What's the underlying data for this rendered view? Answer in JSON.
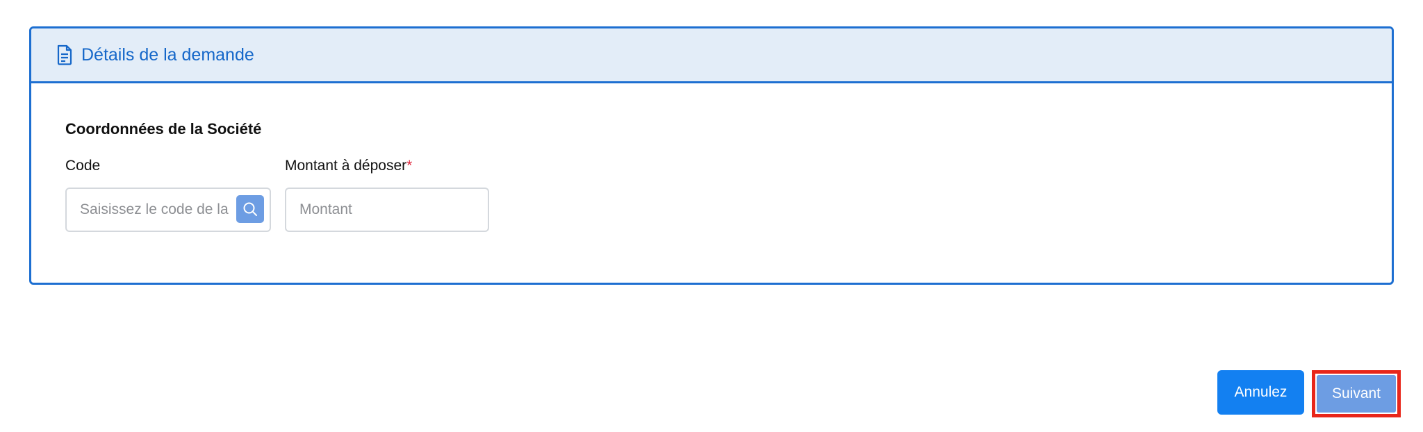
{
  "card": {
    "title": "Détails de la demande",
    "title_icon": "document-icon"
  },
  "section": {
    "title": "Coordonnées de la Société"
  },
  "fields": {
    "code": {
      "label": "Code",
      "placeholder": "Saisissez le code de la",
      "value": "",
      "button_icon": "search-icon"
    },
    "montant": {
      "label": "Montant à déposer",
      "required_mark": "*",
      "placeholder": "Montant",
      "value": ""
    }
  },
  "actions": {
    "cancel_label": "Annulez",
    "next_label": "Suivant"
  },
  "colors": {
    "primary": "#1380f1",
    "primary_disabled": "#6d9de3",
    "header_bg": "#e3edf8",
    "border": "#1d6fd1",
    "required": "#e0243b",
    "highlight": "#e8261a"
  }
}
